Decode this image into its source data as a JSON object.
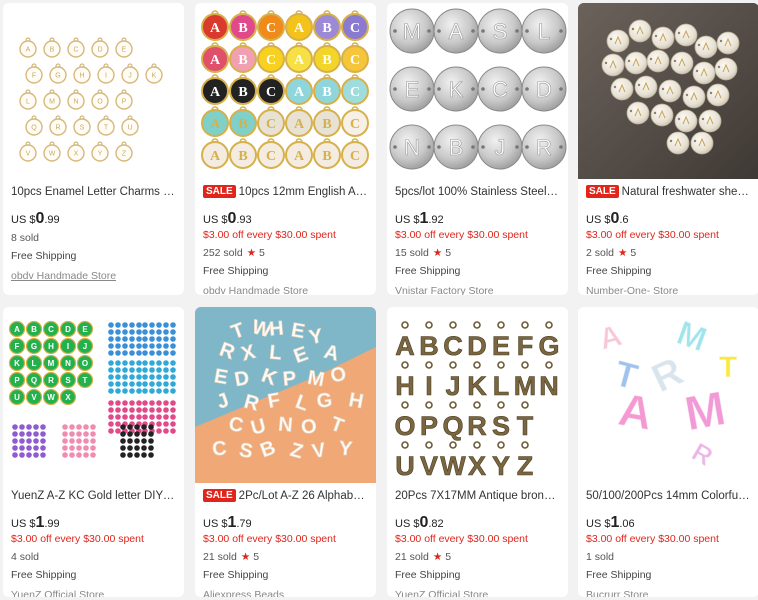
{
  "products": [
    {
      "title": "10pcs Enamel Letter Charms Whit...",
      "sale": false,
      "price_prefix": "US $",
      "price_int": "0",
      "price_dec": ".99",
      "promo": "",
      "sold": "8 sold",
      "rating": "",
      "shipping": "Free Shipping",
      "store": "obdv Handmade Store",
      "image": "white-enamel-letter-charms",
      "image_letters": [
        "A",
        "B",
        "C",
        "D",
        "E",
        "F",
        "G",
        "H",
        "I",
        "J",
        "K",
        "L",
        "M",
        "N",
        "O",
        "P",
        "Q",
        "R",
        "S",
        "T",
        "U",
        "V",
        "W",
        "X",
        "Y",
        "Z"
      ]
    },
    {
      "title": "10pcs 12mm English Alpha...",
      "sale": true,
      "sale_label": "SALE",
      "price_prefix": "US $",
      "price_int": "0",
      "price_dec": ".93",
      "promo": "$3.00 off every $30.00 spent",
      "sold": "252 sold",
      "rating": "5",
      "shipping": "Free Shipping",
      "store": "obdv Handmade Store",
      "image": "colorful-enamel-abc-charms",
      "image_letters": [
        "A",
        "B",
        "C",
        "A",
        "B",
        "C",
        "A",
        "B",
        "C",
        "A",
        "B",
        "C",
        "A",
        "B",
        "C",
        "A",
        "B",
        "C",
        "A",
        "B",
        "C",
        "A",
        "B",
        "C",
        "A",
        "B",
        "C",
        "A",
        "B",
        "C"
      ]
    },
    {
      "title": "5pcs/lot 100% Stainless Steel Initia...",
      "sale": false,
      "price_prefix": "US $",
      "price_int": "1",
      "price_dec": ".92",
      "promo": "$3.00 off every $30.00 spent",
      "sold": "15 sold",
      "rating": "5",
      "shipping": "Free Shipping",
      "store": "Vnistar Factory Store",
      "image": "steel-letter-discs",
      "image_letters": [
        "M",
        "A",
        "S",
        "L",
        "E",
        "K",
        "C",
        "D",
        "N",
        "B",
        "J",
        "R"
      ]
    },
    {
      "title": "Natural freshwater shell be...",
      "sale": true,
      "sale_label": "SALE",
      "price_prefix": "US $",
      "price_int": "0",
      "price_dec": ".6",
      "promo": "$3.00 off every $30.00 spent",
      "sold": "2 sold",
      "rating": "5",
      "shipping": "Free Shipping",
      "store": "Number-One- Store",
      "image": "shell-letter-beads",
      "image_letters": []
    },
    {
      "title": "YuenZ A-Z KC Gold letter DIY Zinc ...",
      "sale": false,
      "price_prefix": "US $",
      "price_int": "1",
      "price_dec": ".99",
      "promo": "$3.00 off every $30.00 spent",
      "sold": "4 sold",
      "rating": "",
      "shipping": "Free Shipping",
      "store": "YuenZ Official Store",
      "image": "green-enamel-letter-charms",
      "image_letters": [
        "A",
        "B",
        "C",
        "D",
        "E",
        "F",
        "G",
        "H",
        "I",
        "J",
        "K",
        "L",
        "M",
        "N",
        "O",
        "P",
        "Q",
        "R",
        "S",
        "T",
        "U",
        "V",
        "W",
        "X",
        "Y",
        "Z"
      ]
    },
    {
      "title": "2Pc/Lot A-Z 26 Alphabet Le...",
      "sale": true,
      "sale_label": "SALE",
      "price_prefix": "US $",
      "price_int": "1",
      "price_dec": ".79",
      "promo": "$3.00 off every $30.00 spent",
      "sold": "21 sold",
      "rating": "5",
      "shipping": "Free Shipping",
      "store": "Aliexpress Beads",
      "image": "white-acrylic-alphabet-beads",
      "image_letters": [
        "T",
        "W",
        "H",
        "E",
        "Y",
        "R",
        "X",
        "L",
        "E",
        "A",
        "E",
        "D",
        "K",
        "P",
        "M",
        "O",
        "J",
        "R",
        "F",
        "L",
        "G",
        "C",
        "U",
        "N",
        "O",
        "T",
        "C",
        "S",
        "B",
        "Z",
        "V",
        "Y",
        "H"
      ]
    },
    {
      "title": "20Pcs 7X17MM Antique bronze Me...",
      "sale": false,
      "price_prefix": "US $",
      "price_int": "0",
      "price_dec": ".82",
      "promo": "$3.00 off every $30.00 spent",
      "sold": "21 sold",
      "rating": "5",
      "shipping": "Free Shipping",
      "store": "YuenZ Official Store",
      "image": "bronze-letter-charms",
      "image_letters": [
        "A",
        "B",
        "C",
        "D",
        "E",
        "F",
        "G",
        "H",
        "I",
        "J",
        "K",
        "L",
        "M",
        "N",
        "O",
        "P",
        "Q",
        "R",
        "S",
        "T",
        "U",
        "V",
        "W",
        "X",
        "Y",
        "Z"
      ]
    },
    {
      "title": "50/100/200Pcs 14mm Colorful Tra...",
      "sale": false,
      "price_prefix": "US $",
      "price_int": "1",
      "price_dec": ".06",
      "promo": "$3.00 off every $30.00 spent",
      "sold": "1 sold",
      "rating": "",
      "shipping": "Free Shipping",
      "store": "Bucrurr Store",
      "image": "transparent-colorful-letter-beads",
      "image_letters": [
        "M",
        "A",
        "R",
        "T",
        "T"
      ]
    }
  ],
  "star_glyph": "★",
  "colors": {
    "sale": "#e1251b",
    "promo": "#e1251b",
    "background": "#f2f2f2"
  }
}
